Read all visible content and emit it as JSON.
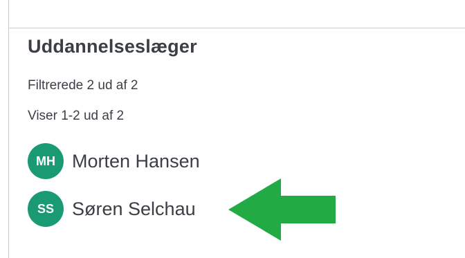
{
  "section": {
    "title": "Uddannelseslæger",
    "filtered_text": "Filtrerede 2 ud af 2",
    "showing_text": "Viser 1-2 ud af 2"
  },
  "people": [
    {
      "initials": "MH",
      "name": "Morten Hansen"
    },
    {
      "initials": "SS",
      "name": "Søren Selchau"
    }
  ],
  "colors": {
    "avatar": "#1a9a73",
    "arrow": "#22aa44"
  },
  "annotation": {
    "icon": "arrow-left-icon"
  }
}
